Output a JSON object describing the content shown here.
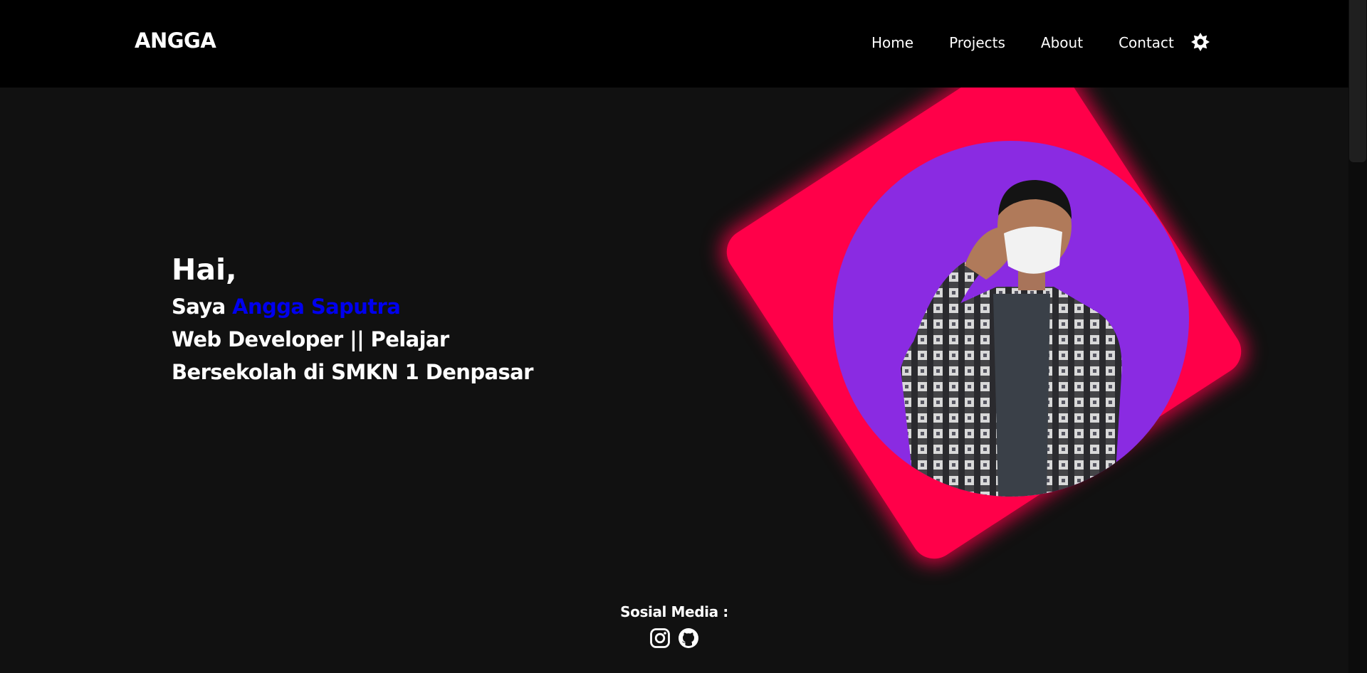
{
  "navbar": {
    "brand": "ANGGA",
    "links": [
      "Home",
      "Projects",
      "About",
      "Contact"
    ],
    "theme_toggle_icon": "sun-icon"
  },
  "hero": {
    "greeting": "Hai,",
    "intro_prefix": "Saya",
    "name": "Angga Saputra",
    "role": "Web Developer || Pelajar",
    "school": "Bersekolah di SMKN 1 Denpasar"
  },
  "social": {
    "title": "Sosial Media :",
    "icons": [
      "instagram-icon",
      "github-icon"
    ]
  },
  "colors": {
    "background": "#111111",
    "navbar": "#000000",
    "accent_card": "#ff0049",
    "portrait_circle": "#8a2be2",
    "name_highlight": "#0000ee"
  }
}
